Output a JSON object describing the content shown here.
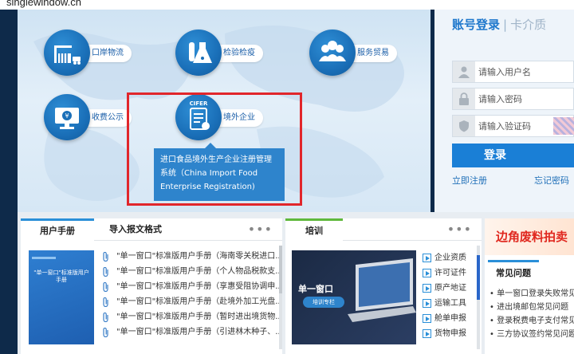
{
  "browser": {
    "url": "singlewindow.cn"
  },
  "services": [
    {
      "label": "口岸物流",
      "icon": "container-crane-icon"
    },
    {
      "label": "检验检疫",
      "icon": "lab-flask-icon"
    },
    {
      "label": "服务贸易",
      "icon": "people-group-icon"
    },
    {
      "label": "收费公示",
      "icon": "monitor-yen-icon"
    },
    {
      "label": "境外企业",
      "icon": "cifer-document-icon",
      "badge": "CIFER"
    }
  ],
  "tooltip": {
    "text": "进口食品境外生产企业注册管理系统（China Import Food Enterprise Registration)"
  },
  "login": {
    "tab_account": "账号登录",
    "tab_separator": "|",
    "tab_card": "卡介质",
    "username_placeholder": "请输入用户名",
    "password_placeholder": "请输入密码",
    "captcha_placeholder": "请输入验证码",
    "login_label": "登录",
    "register_label": "立即注册",
    "forgot_label": "忘记密码"
  },
  "manual_panel": {
    "tab_manual": "用户手册",
    "tab_import": "导入报文格式",
    "more": "•••",
    "cover_title": "\"单一窗口\"标准版用户手册",
    "items": [
      "\"单一窗口\"标准版用户手册（海南零关税进口...",
      "\"单一窗口\"标准版用户手册（个人物品税款支...",
      "\"单一窗口\"标准版用户手册（享惠受阻协调申...",
      "\"单一窗口\"标准版用户手册（赴境外加工光盘...",
      "\"单一窗口\"标准版用户手册（暂时进出境货物...",
      "\"单一窗口\"标准版用户手册（引进林木种子、..."
    ]
  },
  "training_panel": {
    "tab_training": "培训",
    "more": "•••",
    "image_title": "单一窗口",
    "image_badge": "培训专栏",
    "items": [
      "企业资质",
      "许可证件",
      "原产地证",
      "运输工具",
      "舱单申报",
      "货物申报"
    ]
  },
  "side_panel": {
    "banner": "边角废料拍卖",
    "faq_title": "常见问题",
    "faq_items": [
      "• 单一窗口登录失败常见问",
      "• 进出境邮包常见问题",
      "• 登录税费电子支付常见问",
      "• 三方协议签约常见问题"
    ]
  }
}
